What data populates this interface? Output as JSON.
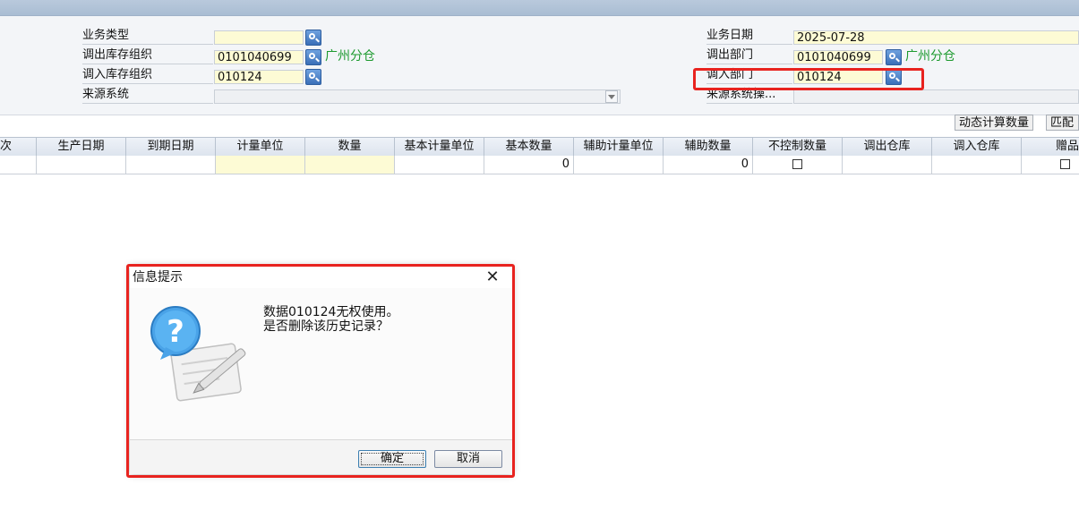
{
  "form": {
    "business_type_label": "业务类型",
    "out_org_label": "调出库存组织",
    "out_org_code": "0101040699",
    "out_org_name": "广州分仓",
    "in_org_label": "调入库存组织",
    "in_org_code": "010124",
    "source_system_label": "来源系统",
    "business_date_label": "业务日期",
    "business_date": "2025-07-28",
    "out_dept_label": "调出部门",
    "out_dept_code": "0101040699",
    "out_dept_name": "广州分仓",
    "in_dept_label": "调入部门",
    "in_dept_code": "010124",
    "source_system_op_label": "来源系统操..."
  },
  "toolbar": {
    "dynamic_calc_label": "动态计算数量",
    "match_label": "匹配"
  },
  "grid": {
    "headers": [
      "次",
      "生产日期",
      "到期日期",
      "计量单位",
      "数量",
      "基本计量单位",
      "基本数量",
      "辅助计量单位",
      "辅助数量",
      "不控制数量",
      "调出仓库",
      "调入仓库",
      "赠品"
    ],
    "row": {
      "basic_qty": "0",
      "aux_qty": "0"
    }
  },
  "dialog": {
    "title": "信息提示",
    "close_glyph": "✕",
    "message_line1": "数据010124无权使用。",
    "message_line2": "是否删除该历史记录？",
    "ok_label": "确定",
    "cancel_label": "取消"
  },
  "colors": {
    "highlight_red": "#e8231f",
    "required_field_yellow": "#fdfbd5",
    "org_name_green": "#1d9a2f"
  }
}
